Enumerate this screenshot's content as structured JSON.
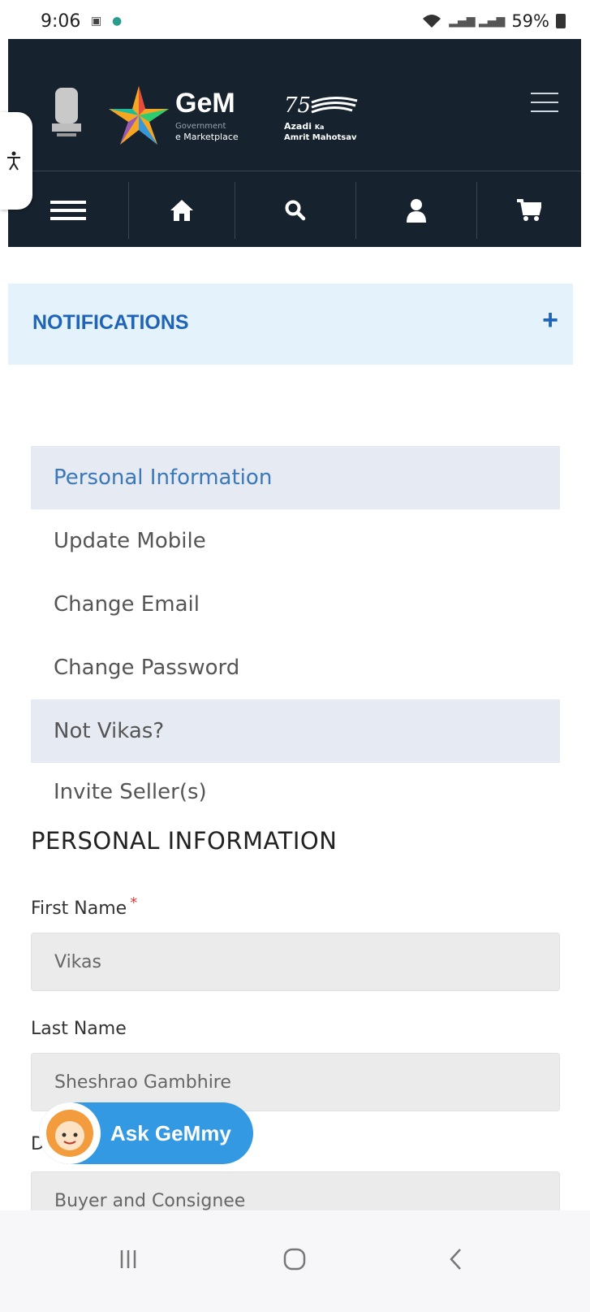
{
  "status_bar": {
    "time": "9:06",
    "battery": "59%"
  },
  "header": {
    "brand_title": "GeM",
    "brand_sub1": "Government",
    "brand_sub2": "e Marketplace",
    "azadi_line1": "Azadi",
    "azadi_line2": "Ka",
    "azadi_line3": "Amrit Mahotsav",
    "nav_icons": [
      "menu-icon",
      "home-icon",
      "search-icon",
      "user-icon",
      "cart-icon"
    ]
  },
  "notifications": {
    "title": "NOTIFICATIONS",
    "toggle": "+"
  },
  "menu": {
    "items": [
      {
        "label": "Personal Information",
        "state": "active"
      },
      {
        "label": "Update Mobile",
        "state": "normal"
      },
      {
        "label": "Change Email",
        "state": "normal"
      },
      {
        "label": "Change Password",
        "state": "normal"
      },
      {
        "label": "Not Vikas?",
        "state": "shaded"
      },
      {
        "label": "Invite Seller(s)",
        "state": "normal"
      }
    ]
  },
  "form": {
    "section_title": "PERSONAL INFORMATION",
    "first_name_label": "First Name",
    "required_mark": "*",
    "first_name_value": "Vikas",
    "last_name_label": "Last Name",
    "last_name_value": "Sheshrao Gambhire",
    "third_label_partial": "D",
    "third_value": "Buyer and Consignee"
  },
  "chatbot": {
    "label": "Ask GeMmy"
  },
  "colors": {
    "header_bg": "#16222e",
    "accent_blue": "#1f64b7",
    "chatbot_blue": "#3399e2"
  }
}
